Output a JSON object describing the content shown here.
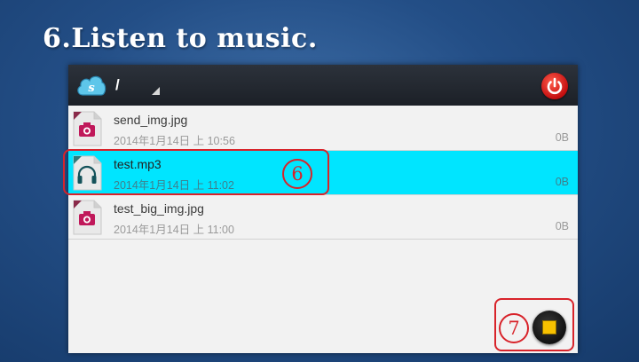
{
  "slide": {
    "title": "6.Listen to music."
  },
  "appbar": {
    "logo_letter": "s",
    "path": "/"
  },
  "files": [
    {
      "name": "send_img.jpg",
      "date": "2014年1月14日 上 10:56",
      "size": "0B",
      "type": "image"
    },
    {
      "name": "test.mp3",
      "date": "2014年1月14日 上 11:02",
      "size": "0B",
      "type": "audio",
      "selected": true
    },
    {
      "name": "test_big_img.jpg",
      "date": "2014年1月14日 上 11:00",
      "size": "0B",
      "type": "image"
    }
  ],
  "annotations": {
    "step6": "6",
    "step7": "7"
  },
  "colors": {
    "selected_row": "#00e5ff",
    "annotation": "#d8232a",
    "power": "#d8171b",
    "stop": "#f7c100"
  }
}
